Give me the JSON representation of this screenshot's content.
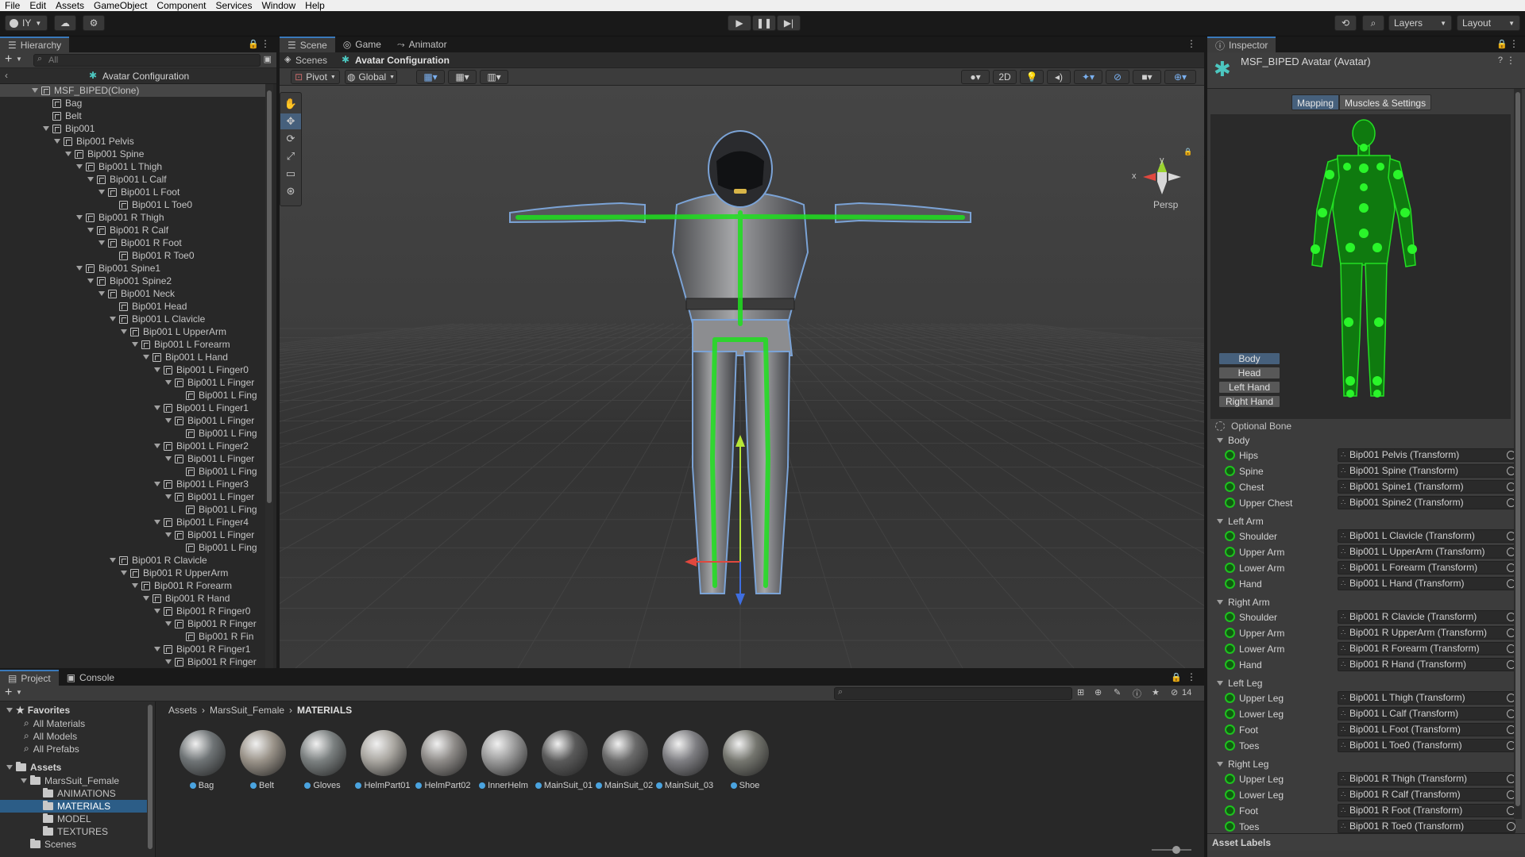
{
  "menubar": [
    "File",
    "Edit",
    "Assets",
    "GameObject",
    "Component",
    "Services",
    "Window",
    "Help"
  ],
  "toolbar": {
    "account": "IY",
    "layers": "Layers",
    "layout": "Layout"
  },
  "hierarchy": {
    "tab": "Hierarchy",
    "search_placeholder": "All",
    "scene_header": "Avatar Configuration",
    "rows": [
      {
        "label": "MSF_BIPED(Clone)",
        "depth": 0,
        "arrow": true
      },
      {
        "label": "Bag",
        "depth": 1,
        "arrow": false
      },
      {
        "label": "Belt",
        "depth": 1,
        "arrow": false
      },
      {
        "label": "Bip001",
        "depth": 1,
        "arrow": true
      },
      {
        "label": "Bip001 Pelvis",
        "depth": 2,
        "arrow": true
      },
      {
        "label": "Bip001 Spine",
        "depth": 3,
        "arrow": true
      },
      {
        "label": "Bip001 L Thigh",
        "depth": 4,
        "arrow": true
      },
      {
        "label": "Bip001 L Calf",
        "depth": 5,
        "arrow": true
      },
      {
        "label": "Bip001 L Foot",
        "depth": 6,
        "arrow": true
      },
      {
        "label": "Bip001 L Toe0",
        "depth": 7,
        "arrow": false
      },
      {
        "label": "Bip001 R Thigh",
        "depth": 4,
        "arrow": true
      },
      {
        "label": "Bip001 R Calf",
        "depth": 5,
        "arrow": true
      },
      {
        "label": "Bip001 R Foot",
        "depth": 6,
        "arrow": true
      },
      {
        "label": "Bip001 R Toe0",
        "depth": 7,
        "arrow": false
      },
      {
        "label": "Bip001 Spine1",
        "depth": 4,
        "arrow": true
      },
      {
        "label": "Bip001 Spine2",
        "depth": 5,
        "arrow": true
      },
      {
        "label": "Bip001 Neck",
        "depth": 6,
        "arrow": true
      },
      {
        "label": "Bip001 Head",
        "depth": 7,
        "arrow": false
      },
      {
        "label": "Bip001 L Clavicle",
        "depth": 7,
        "arrow": true
      },
      {
        "label": "Bip001 L UpperArm",
        "depth": 8,
        "arrow": true
      },
      {
        "label": "Bip001 L Forearm",
        "depth": 9,
        "arrow": true
      },
      {
        "label": "Bip001 L Hand",
        "depth": 10,
        "arrow": true
      },
      {
        "label": "Bip001 L Finger0",
        "depth": 11,
        "arrow": true
      },
      {
        "label": "Bip001 L Finger",
        "depth": 12,
        "arrow": true
      },
      {
        "label": "Bip001 L Fing",
        "depth": 13,
        "arrow": false
      },
      {
        "label": "Bip001 L Finger1",
        "depth": 11,
        "arrow": true
      },
      {
        "label": "Bip001 L Finger",
        "depth": 12,
        "arrow": true
      },
      {
        "label": "Bip001 L Fing",
        "depth": 13,
        "arrow": false
      },
      {
        "label": "Bip001 L Finger2",
        "depth": 11,
        "arrow": true
      },
      {
        "label": "Bip001 L Finger",
        "depth": 12,
        "arrow": true
      },
      {
        "label": "Bip001 L Fing",
        "depth": 13,
        "arrow": false
      },
      {
        "label": "Bip001 L Finger3",
        "depth": 11,
        "arrow": true
      },
      {
        "label": "Bip001 L Finger",
        "depth": 12,
        "arrow": true
      },
      {
        "label": "Bip001 L Fing",
        "depth": 13,
        "arrow": false
      },
      {
        "label": "Bip001 L Finger4",
        "depth": 11,
        "arrow": true
      },
      {
        "label": "Bip001 L Finger",
        "depth": 12,
        "arrow": true
      },
      {
        "label": "Bip001 L Fing",
        "depth": 13,
        "arrow": false
      },
      {
        "label": "Bip001 R Clavicle",
        "depth": 7,
        "arrow": true
      },
      {
        "label": "Bip001 R UpperArm",
        "depth": 8,
        "arrow": true
      },
      {
        "label": "Bip001 R Forearm",
        "depth": 9,
        "arrow": true
      },
      {
        "label": "Bip001 R Hand",
        "depth": 10,
        "arrow": true
      },
      {
        "label": "Bip001 R Finger0",
        "depth": 11,
        "arrow": true
      },
      {
        "label": "Bip001 R Finger",
        "depth": 12,
        "arrow": true
      },
      {
        "label": "Bip001 R Fin",
        "depth": 13,
        "arrow": false
      },
      {
        "label": "Bip001 R Finger1",
        "depth": 11,
        "arrow": true
      },
      {
        "label": "Bip001 R Finger",
        "depth": 12,
        "arrow": true
      }
    ]
  },
  "scene": {
    "tabs": [
      {
        "label": "Scene",
        "icon": "scene-icon"
      },
      {
        "label": "Game",
        "icon": "gamepad-icon"
      },
      {
        "label": "Animator",
        "icon": "animator-icon"
      }
    ],
    "breadcrumb_root": "Scenes",
    "breadcrumb_current": "Avatar Configuration",
    "pivot": "Pivot",
    "global": "Global",
    "mode_2d": "2D",
    "persp": "Persp",
    "axis_x": "x",
    "axis_y": "y"
  },
  "inspector": {
    "tab": "Inspector",
    "title": "MSF_BIPED Avatar (Avatar)",
    "subtabs": [
      "Mapping",
      "Muscles & Settings"
    ],
    "body_buttons": [
      "Body",
      "Head",
      "Left Hand",
      "Right Hand"
    ],
    "optional_bone": "Optional Bone",
    "groups": [
      {
        "name": "Body",
        "rows": [
          {
            "label": "Hips",
            "value": "Bip001 Pelvis (Transform)"
          },
          {
            "label": "Spine",
            "value": "Bip001 Spine (Transform)"
          },
          {
            "label": "Chest",
            "value": "Bip001 Spine1 (Transform)"
          },
          {
            "label": "Upper Chest",
            "value": "Bip001 Spine2 (Transform)"
          }
        ]
      },
      {
        "name": "Left Arm",
        "rows": [
          {
            "label": "Shoulder",
            "value": "Bip001 L Clavicle (Transform)"
          },
          {
            "label": "Upper Arm",
            "value": "Bip001 L UpperArm (Transform)"
          },
          {
            "label": "Lower Arm",
            "value": "Bip001 L Forearm (Transform)"
          },
          {
            "label": "Hand",
            "value": "Bip001 L Hand (Transform)"
          }
        ]
      },
      {
        "name": "Right Arm",
        "rows": [
          {
            "label": "Shoulder",
            "value": "Bip001 R Clavicle (Transform)"
          },
          {
            "label": "Upper Arm",
            "value": "Bip001 R UpperArm (Transform)"
          },
          {
            "label": "Lower Arm",
            "value": "Bip001 R Forearm (Transform)"
          },
          {
            "label": "Hand",
            "value": "Bip001 R Hand (Transform)"
          }
        ]
      },
      {
        "name": "Left Leg",
        "rows": [
          {
            "label": "Upper Leg",
            "value": "Bip001 L Thigh (Transform)"
          },
          {
            "label": "Lower Leg",
            "value": "Bip001 L Calf (Transform)"
          },
          {
            "label": "Foot",
            "value": "Bip001 L Foot (Transform)"
          },
          {
            "label": "Toes",
            "value": "Bip001 L Toe0 (Transform)"
          }
        ]
      },
      {
        "name": "Right Leg",
        "rows": [
          {
            "label": "Upper Leg",
            "value": "Bip001 R Thigh (Transform)"
          },
          {
            "label": "Lower Leg",
            "value": "Bip001 R Calf (Transform)"
          },
          {
            "label": "Foot",
            "value": "Bip001 R Foot (Transform)"
          },
          {
            "label": "Toes",
            "value": "Bip001 R Toe0 (Transform)"
          }
        ]
      }
    ],
    "asset_labels": "Asset Labels"
  },
  "project": {
    "tabs": [
      {
        "label": "Project",
        "icon": "folder-icon"
      },
      {
        "label": "Console",
        "icon": "console-icon"
      }
    ],
    "hidden_count": "14",
    "breadcrumb": [
      "Assets",
      "MarsSuit_Female",
      "MATERIALS"
    ],
    "favorites_label": "Favorites",
    "favorites": [
      "All Materials",
      "All Models",
      "All Prefabs"
    ],
    "assets_label": "Assets",
    "tree": [
      {
        "label": "MarsSuit_Female",
        "depth": 1,
        "selected": false
      },
      {
        "label": "ANIMATIONS",
        "depth": 2,
        "selected": false
      },
      {
        "label": "MATERIALS",
        "depth": 2,
        "selected": true
      },
      {
        "label": "MODEL",
        "depth": 2,
        "selected": false
      },
      {
        "label": "TEXTURES",
        "depth": 2,
        "selected": false
      },
      {
        "label": "Scenes",
        "depth": 1,
        "selected": false
      }
    ],
    "materials": [
      {
        "name": "Bag",
        "color": "#6f7476"
      },
      {
        "name": "Belt",
        "color": "#9a9389"
      },
      {
        "name": "Gloves",
        "color": "#7b8080"
      },
      {
        "name": "HelmPart01",
        "color": "#a9a6a0"
      },
      {
        "name": "HelmPart02",
        "color": "#8e8b88"
      },
      {
        "name": "InnerHelm",
        "color": "#9a9a9a"
      },
      {
        "name": "MainSuit_01",
        "color": "#5a5a5a"
      },
      {
        "name": "MainSuit_02",
        "color": "#6a6a6a"
      },
      {
        "name": "MainSuit_03",
        "color": "#7e7e82"
      },
      {
        "name": "Shoe",
        "color": "#75766f"
      }
    ]
  },
  "colors": {
    "accent": "#3a79bb",
    "bone_green": "#1ec21e",
    "selection": "#2c5d87"
  }
}
